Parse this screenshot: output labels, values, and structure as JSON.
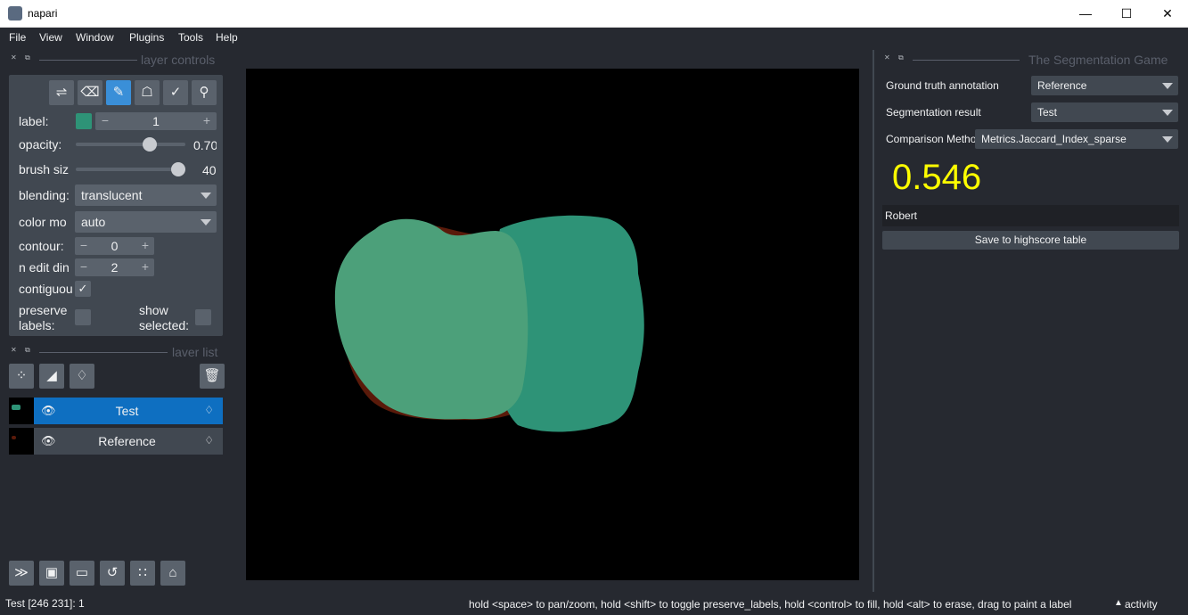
{
  "window": {
    "title": "napari"
  },
  "menu": [
    "File",
    "View",
    "Window",
    "Plugins",
    "Tools",
    "Help"
  ],
  "layer_controls": {
    "header": "layer controls",
    "tools": [
      "shuffle-icon",
      "eraser-icon",
      "paintbrush-icon",
      "fill-bucket-icon",
      "picker-icon",
      "zoom-icon"
    ],
    "label_label": "label:",
    "label_value": "1",
    "label_color": "#2e9377",
    "opacity_label": "opacity:",
    "opacity_value": "0.70",
    "opacity_fraction": 0.7,
    "brush_label": "brush siz",
    "brush_value": "40",
    "brush_fraction": 1.0,
    "blending_label": "blending:",
    "blending_value": "translucent",
    "color_mode_label": "color mo",
    "color_mode_value": "auto",
    "contour_label": "contour:",
    "contour_value": "0",
    "n_edit_label": "n edit din",
    "n_edit_value": "2",
    "contiguous_label": "contiguou",
    "contiguous_checked": true,
    "preserve_label": "preserve\nlabels:",
    "show_selected_label": "show\nselected:"
  },
  "layer_list": {
    "header": "laver list",
    "layers": [
      {
        "name": "Test",
        "selected": true
      },
      {
        "name": "Reference",
        "selected": false
      }
    ]
  },
  "right_panel": {
    "header": "The Segmentation Game",
    "ground_truth_label": "Ground truth annotation",
    "ground_truth_value": "Reference",
    "seg_result_label": "Segmentation result",
    "seg_result_value": "Test",
    "comparison_label": "Comparison Method",
    "comparison_value": "Metrics.Jaccard_Index_sparse",
    "score": "0.546",
    "name_value": "Robert",
    "save_button": "Save to highscore table"
  },
  "status": {
    "left": "Test [246 231]: 1",
    "help": "hold <space> to pan/zoom, hold <shift> to toggle preserve_labels, hold <control> to fill, hold <alt> to erase, drag to paint a label",
    "activity": "activity"
  },
  "colors": {
    "test_label": "#2e9377",
    "reference_label": "#5a1a0a",
    "overlap": "#4ca07a",
    "score": "#ffff00",
    "accent": "#0e6fc1"
  }
}
